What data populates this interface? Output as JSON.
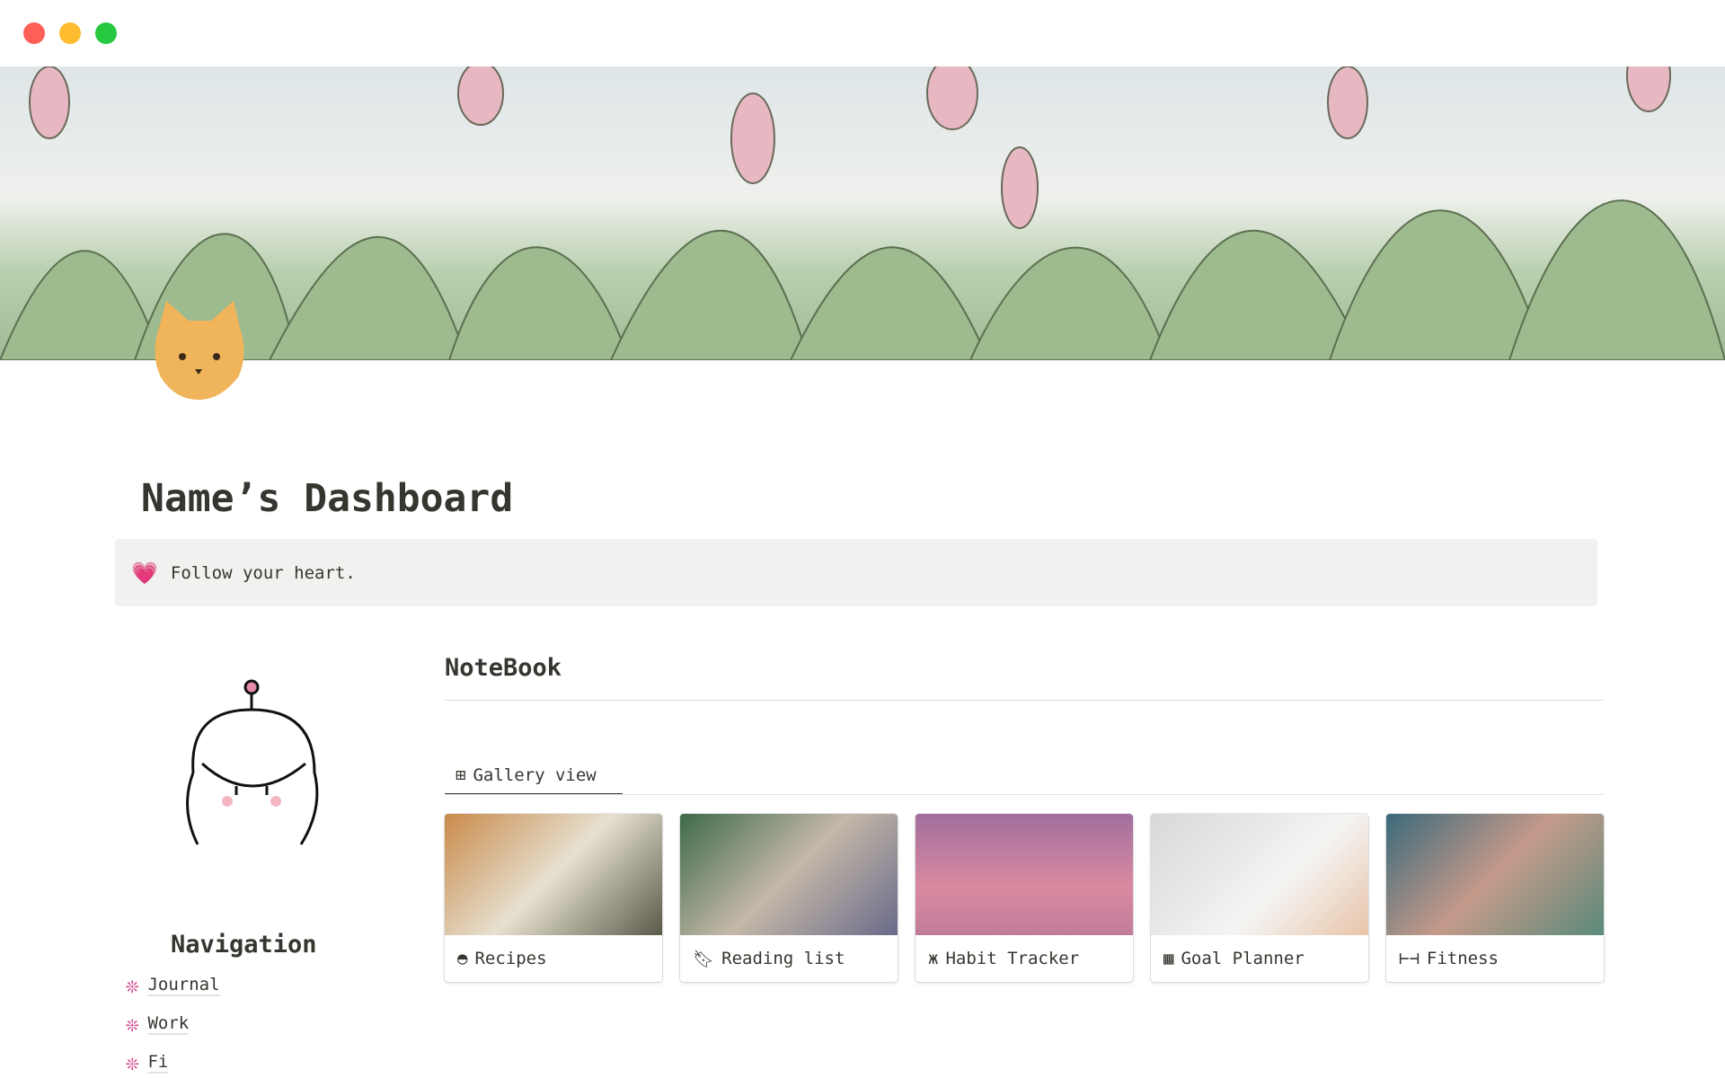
{
  "window": {
    "controls": [
      "close",
      "minimize",
      "maximize"
    ],
    "colors": [
      "#fe5f57",
      "#febc2e",
      "#28c840"
    ]
  },
  "page": {
    "title": "Name’s Dashboard",
    "callout": {
      "icon": "pink-heart",
      "emoji": "💗",
      "text": "Follow your heart."
    }
  },
  "notebook": {
    "heading": "NoteBook",
    "view_tab": "Gallery view",
    "cards": [
      {
        "label": "Recipes",
        "icon": "bowl-icon"
      },
      {
        "label": "Reading list",
        "icon": "bookmark-icon"
      },
      {
        "label": "Habit Tracker",
        "icon": "butterfly-icon"
      },
      {
        "label": "Goal Planner",
        "icon": "calendar-icon"
      },
      {
        "label": "Fitness",
        "icon": "dumbbell-icon"
      }
    ]
  },
  "navigation": {
    "heading": "Navigation",
    "items": [
      {
        "label": "Journal"
      },
      {
        "label": "Work"
      },
      {
        "label": "Fi"
      }
    ]
  }
}
